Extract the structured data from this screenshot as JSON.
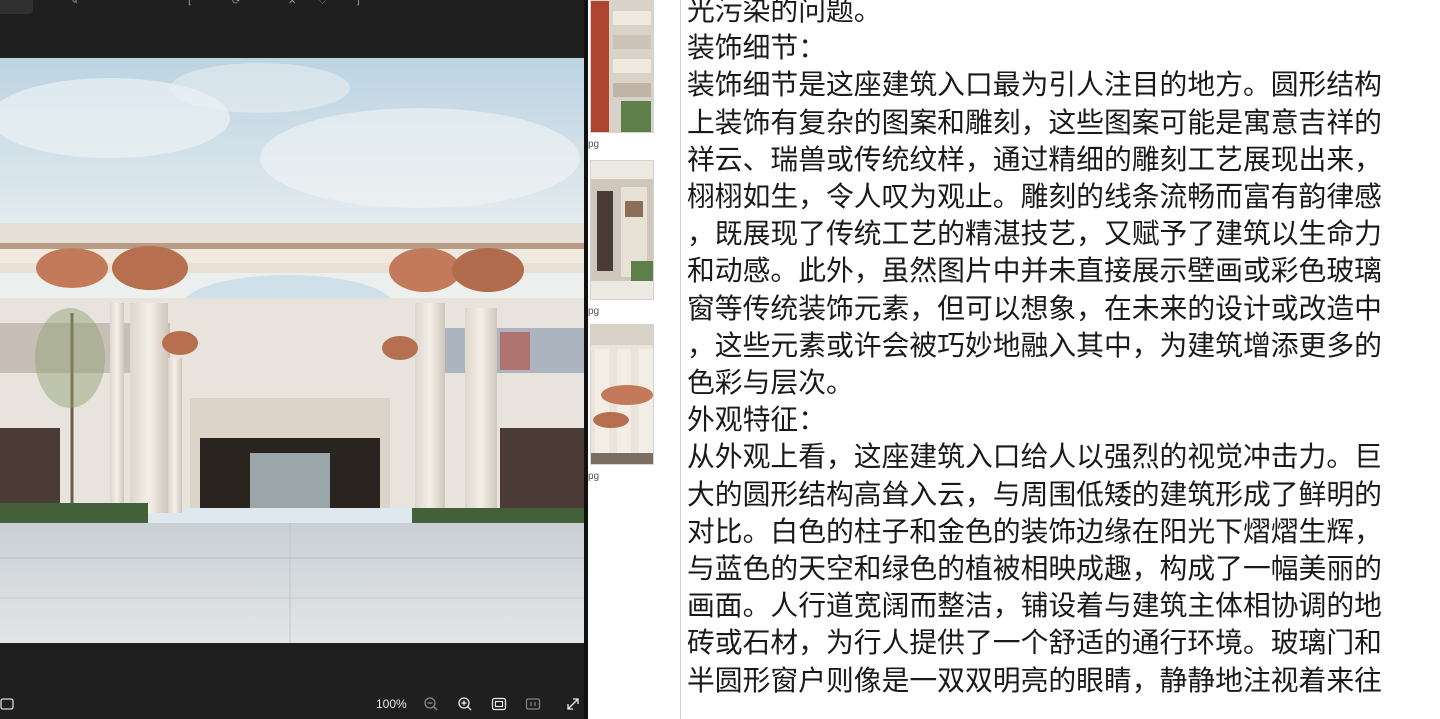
{
  "viewer": {
    "zoom_label": "100%",
    "icons": [
      "image-icon",
      "zoom-out-icon",
      "zoom-in-icon",
      "fit-screen-icon",
      "actual-size-icon",
      "fullscreen-icon"
    ]
  },
  "files": [
    {
      "name": "pg"
    },
    {
      "name": "pg"
    },
    {
      "name": "pg"
    }
  ],
  "text_lines": [
    "光污染的问题。",
    "装饰细节：",
    "装饰细节是这座建筑入口最为引人注目的地方。圆形结构",
    "上装饰有复杂的图案和雕刻，这些图案可能是寓意吉祥的",
    "祥云、瑞兽或传统纹样，通过精细的雕刻工艺展现出来，",
    "栩栩如生，令人叹为观止。雕刻的线条流畅而富有韵律感",
    "，既展现了传统工艺的精湛技艺，又赋予了建筑以生命力",
    "和动感。此外，虽然图片中并未直接展示壁画或彩色玻璃",
    "窗等传统装饰元素，但可以想象，在未来的设计或改造中",
    "，这些元素或许会被巧妙地融入其中，为建筑增添更多的",
    "色彩与层次。",
    "外观特征：",
    "从外观上看，这座建筑入口给人以强烈的视觉冲击力。巨",
    "大的圆形结构高耸入云，与周围低矮的建筑形成了鲜明的",
    "对比。白色的柱子和金色的装饰边缘在阳光下熠熠生辉，",
    "与蓝色的天空和绿色的植被相映成趣，构成了一幅美丽的",
    "画面。人行道宽阔而整洁，铺设着与建筑主体相协调的地",
    "砖或石材，为行人提供了一个舒适的通行环境。玻璃门和",
    "半圆形窗户则像是一双双明亮的眼睛，静静地注视着来往"
  ],
  "colors": {
    "viewer_bg": "#1f1f1f",
    "text": "#1a1a1a",
    "accent_column": "#c27a5a"
  }
}
